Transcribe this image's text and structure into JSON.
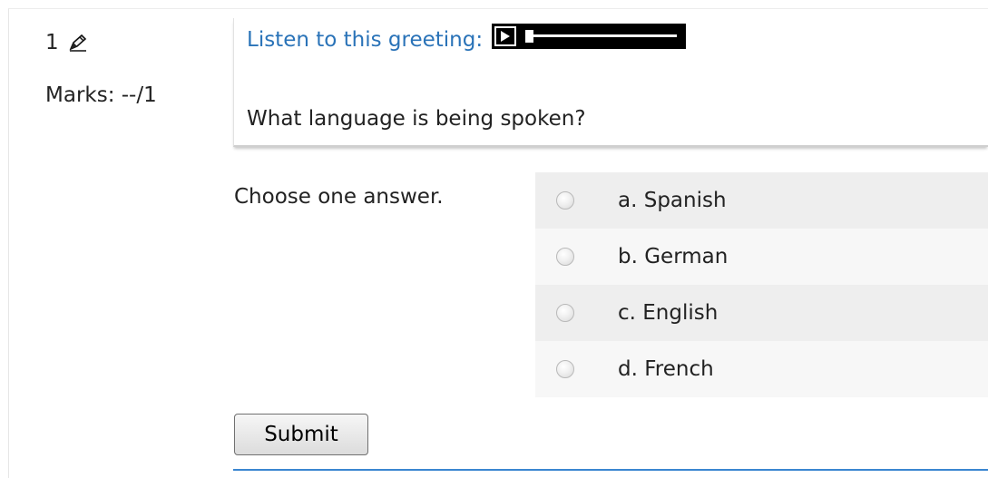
{
  "question": {
    "number": "1",
    "edit_icon": "pencil-edit-icon",
    "marks_label": "Marks: --/1",
    "listen_text": "Listen to this greeting:",
    "audio_player": {
      "icon": "play-icon",
      "progress": 0.0
    },
    "prompt": "What language is being spoken?",
    "instruction": "Choose one answer.",
    "options": [
      {
        "label": "a. Spanish",
        "selected": false
      },
      {
        "label": "b. German",
        "selected": false
      },
      {
        "label": "c. English",
        "selected": false
      },
      {
        "label": "d. French",
        "selected": false
      }
    ],
    "submit_label": "Submit"
  },
  "colors": {
    "link_blue": "#2a73b8",
    "rule_blue": "#3a86d1",
    "row_shade": "#eeeeee",
    "row_light": "#f7f7f7"
  }
}
